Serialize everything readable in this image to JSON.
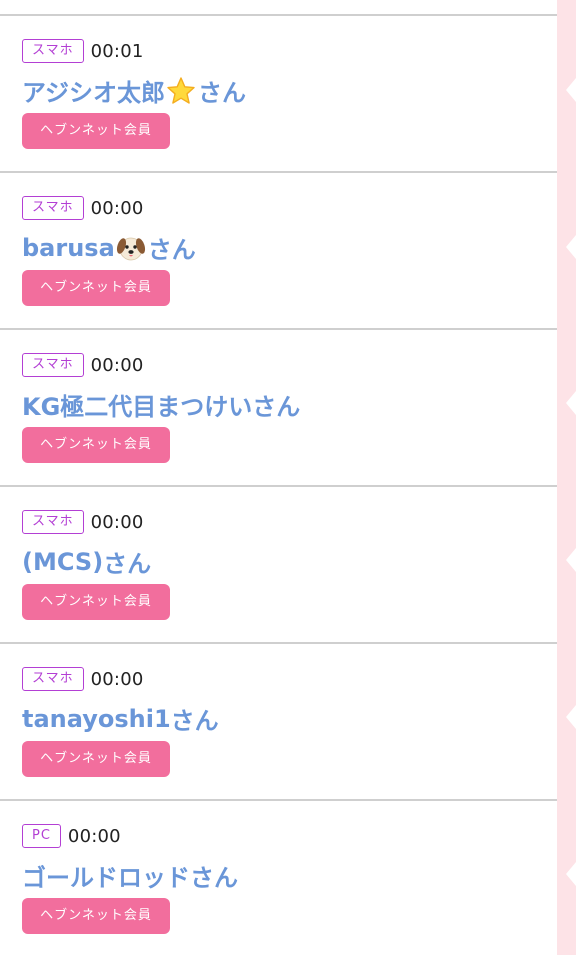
{
  "members": [
    {
      "device": "スマホ",
      "time": "00:01",
      "name": "アジシオ太郎",
      "emoji": "star-icon",
      "suffix": "さん",
      "badge": "ヘブンネット会員"
    },
    {
      "device": "スマホ",
      "time": "00:00",
      "name": "barusa",
      "emoji": "dog-face-icon",
      "suffix": "さん",
      "badge": "ヘブンネット会員"
    },
    {
      "device": "スマホ",
      "time": "00:00",
      "name": "KG極二代目まつけい",
      "emoji": "",
      "suffix": "さん",
      "badge": "ヘブンネット会員"
    },
    {
      "device": "スマホ",
      "time": "00:00",
      "name": "(MCS)",
      "emoji": "",
      "suffix": "さん",
      "badge": "ヘブンネット会員"
    },
    {
      "device": "スマホ",
      "time": "00:00",
      "name": "tanayoshi1",
      "emoji": "",
      "suffix": "さん",
      "badge": "ヘブンネット会員"
    },
    {
      "device": "PC",
      "time": "00:00",
      "name": "ゴールドロッド",
      "emoji": "",
      "suffix": "さん",
      "badge": "ヘブンネット会員"
    }
  ],
  "colors": {
    "name": "#6a96d8",
    "device_border": "#b33fd4",
    "badge_bg": "#f26e9d",
    "side_panel": "#fde3e7",
    "divider": "#cfcfcf"
  }
}
